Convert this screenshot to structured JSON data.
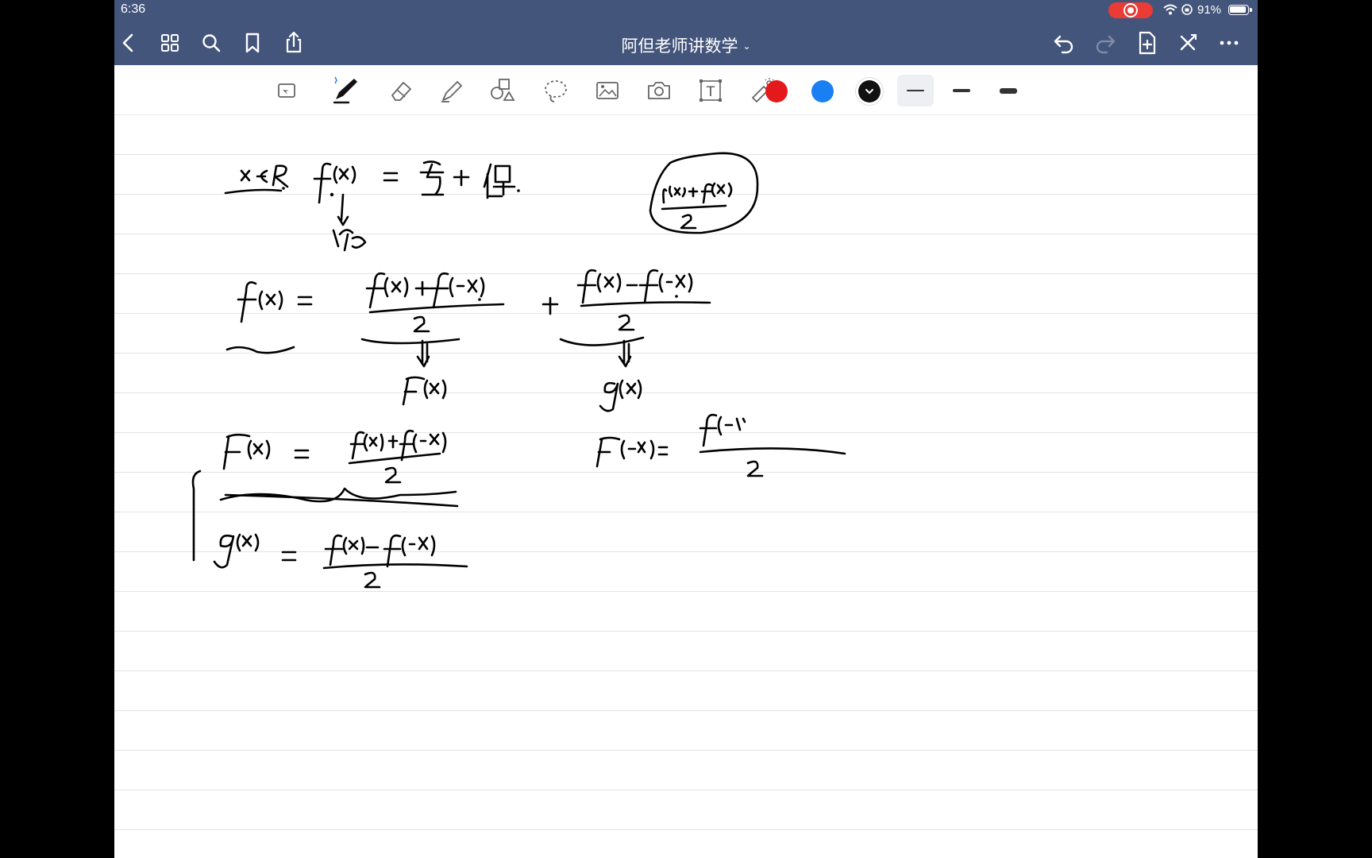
{
  "status_bar": {
    "time": "6:36",
    "battery": "91%"
  },
  "document": {
    "title": "阿但老师讲数学"
  },
  "icons": {
    "back": "chevron-left-icon",
    "grid": "grid-icon",
    "search": "search-icon",
    "bookmark": "bookmark-icon",
    "share": "share-icon",
    "undo": "undo-icon",
    "redo": "redo-icon",
    "add_page": "add-page-icon",
    "close": "close-icon",
    "more": "more-icon"
  },
  "toolbar": {
    "tools": [
      "selection-icon",
      "pen-icon",
      "eraser-icon",
      "highlighter-icon",
      "shapes-icon",
      "lasso-icon",
      "image-icon",
      "camera-icon",
      "text-icon",
      "laser-pointer-icon"
    ],
    "text_tool_label": "T",
    "selected_tool": "pen",
    "colors": [
      "#e3191c",
      "#1a7ff2",
      "#111111"
    ],
    "selected_color": "#111111",
    "stroke_widths": [
      "thin",
      "medium",
      "thick"
    ],
    "selected_width": "thin"
  }
}
